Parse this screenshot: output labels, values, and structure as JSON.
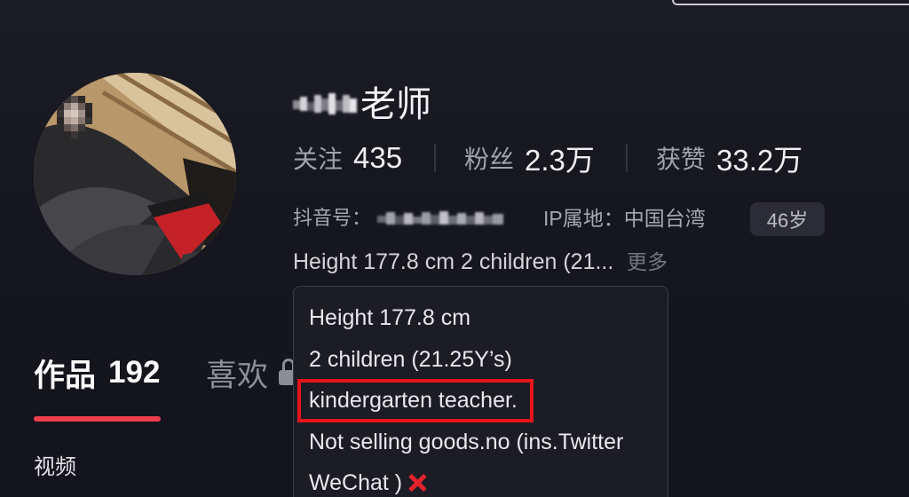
{
  "profile": {
    "name_suffix": "老师",
    "stats": [
      {
        "label": "关注",
        "value": "435"
      },
      {
        "label": "粉丝",
        "value": "2.3万"
      },
      {
        "label": "获赞",
        "value": "33.2万"
      }
    ],
    "douyin_id_label": "抖音号：",
    "ip_location": "IP属地：中国台湾",
    "age_badge": "46岁",
    "bio_preview": "Height 177.8 cm 2 children (21...",
    "more_label": "更多"
  },
  "bio_popup": {
    "lines": [
      {
        "text": "Height 177.8 cm",
        "highlighted": false
      },
      {
        "text": "2 children (21.25Y’s)",
        "highlighted": false
      },
      {
        "text": "kindergarten teacher.",
        "highlighted": true
      },
      {
        "text": "Not selling goods.no (ins.Twitter",
        "highlighted": false
      },
      {
        "text": "WeChat )",
        "highlighted": false,
        "trailing_icon": "cross-mark-icon"
      }
    ]
  },
  "tabs": [
    {
      "label": "作品",
      "count": "192",
      "active": true
    },
    {
      "label": "喜欢",
      "locked": true,
      "lock_icon": "lock-icon"
    }
  ],
  "sub_tabs": [
    {
      "label": "视频",
      "active": true
    }
  ],
  "colors": {
    "background": "#16161f",
    "accent": "#ec3f4f",
    "highlight_box": "#e8141c",
    "cross_mark": "#e3222c"
  }
}
